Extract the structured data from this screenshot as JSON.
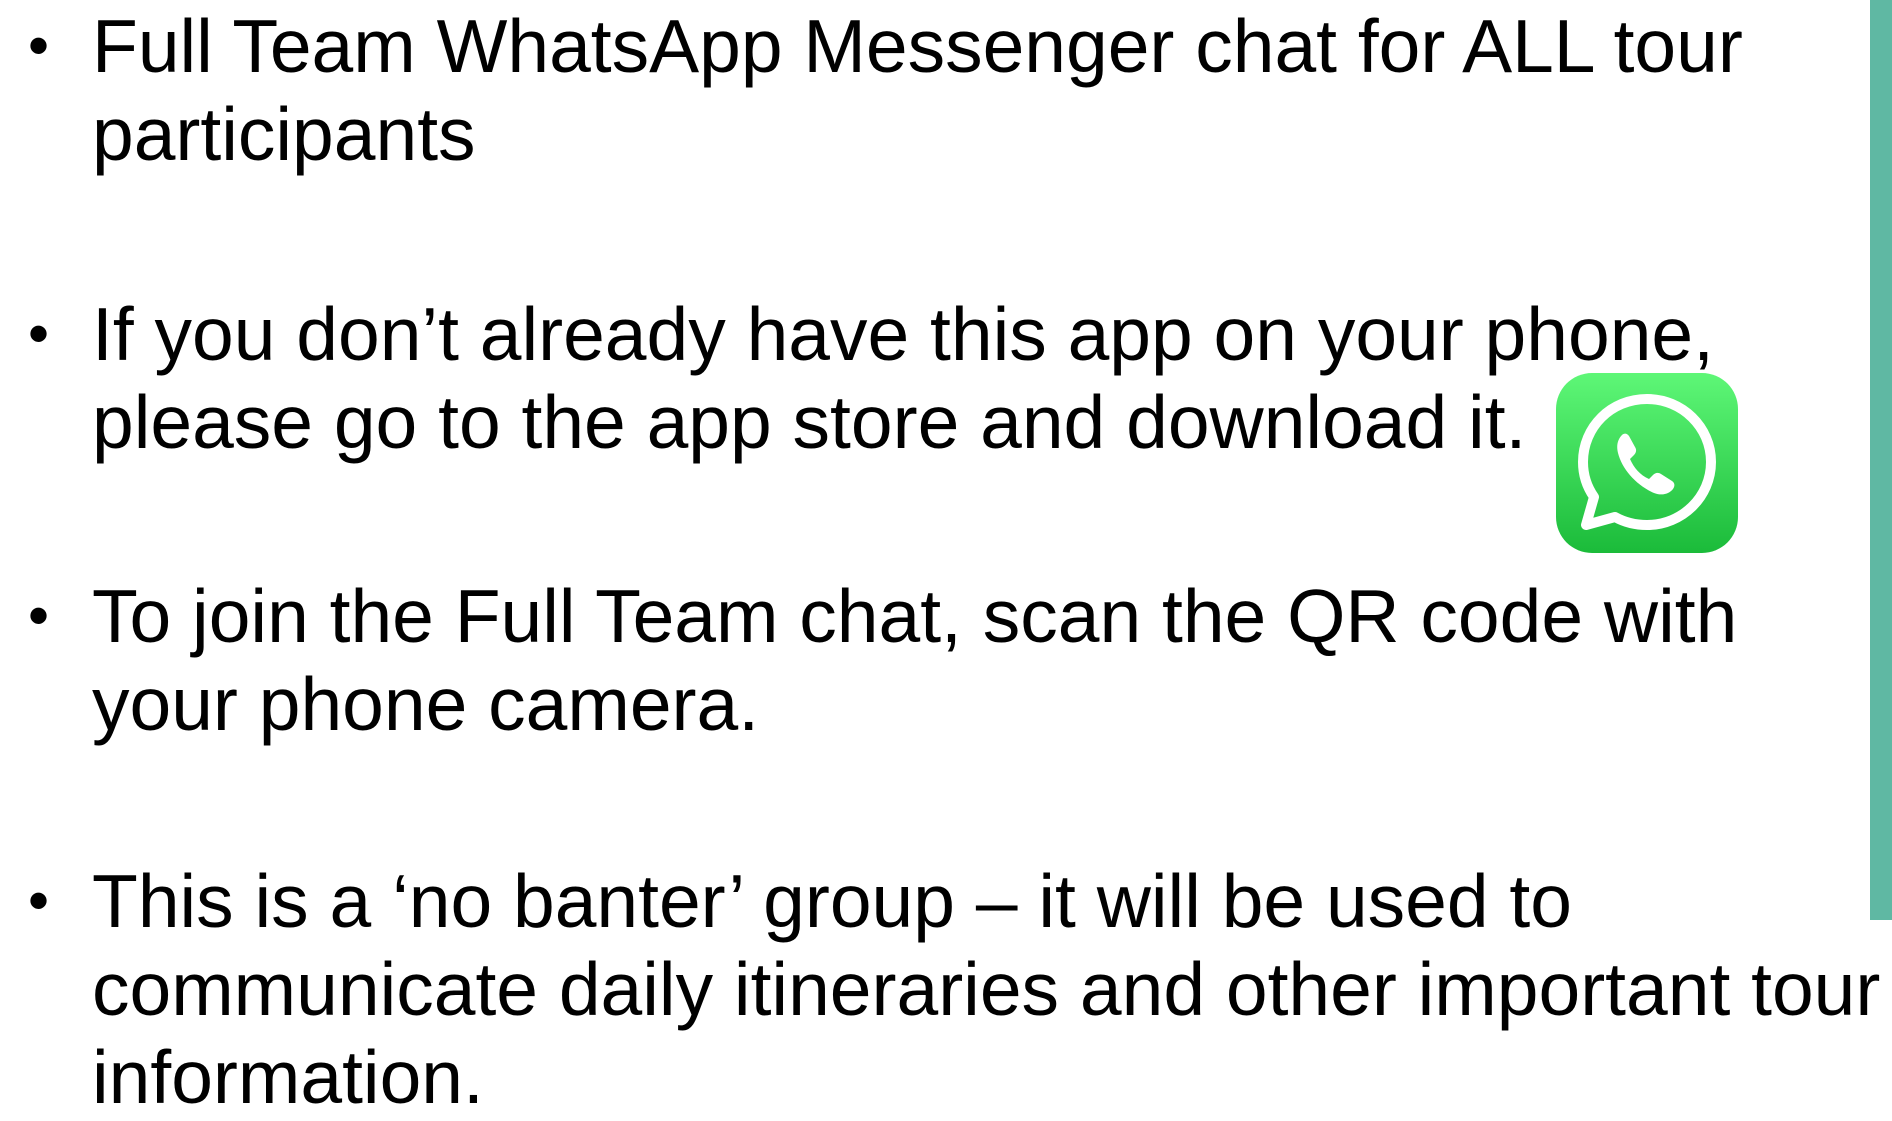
{
  "bullets": [
    {
      "marker": "•",
      "lines": [
        "Full Team WhatsApp Messenger chat for ALL tour",
        "participants"
      ]
    },
    {
      "marker": "•",
      "lines": [
        "If you don’t already have this app on your phone,",
        "please go to the app store and download it."
      ]
    },
    {
      "marker": "•",
      "lines": [
        "To join the Full Team chat, scan the QR code with",
        "your phone camera."
      ]
    },
    {
      "marker": "•",
      "lines": [
        "This is a ‘no banter’ group – it will be used to",
        "communicate daily itineraries and other important tour",
        "information."
      ]
    }
  ],
  "logo": {
    "icon": "whatsapp-icon",
    "gradient_top": "#5ef777",
    "gradient_bottom": "#1bbb3a"
  },
  "accent_bar_color": "#5fb8a3"
}
